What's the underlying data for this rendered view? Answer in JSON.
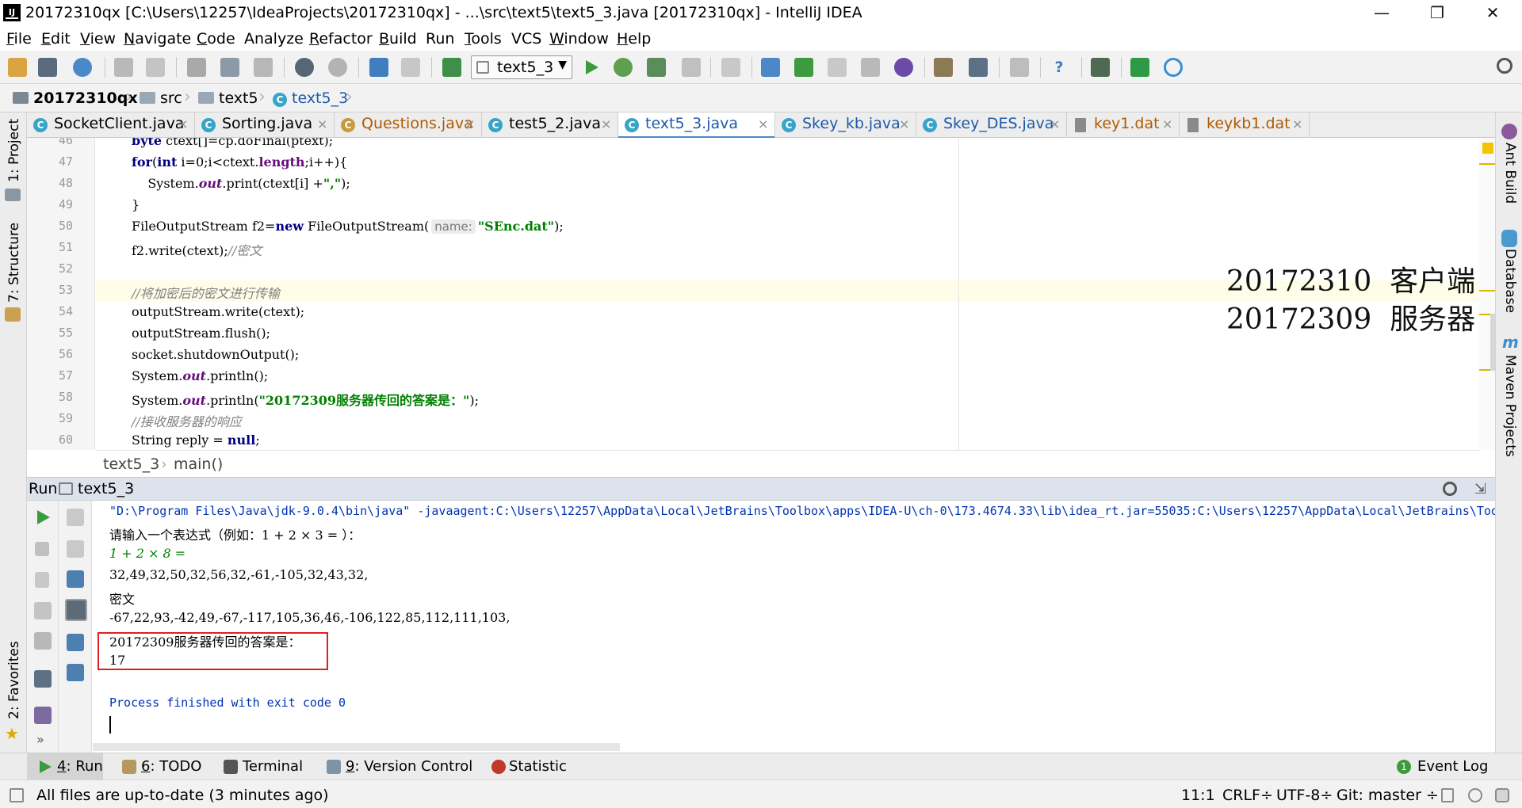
{
  "window": {
    "title": "20172310qx [C:\\Users\\12257\\IdeaProjects\\20172310qx] - ...\\src\\text5\\text5_3.java [20172310qx] - IntelliJ IDEA",
    "app_icon_label": "IJ",
    "minimize_glyph": "—",
    "maximize_glyph": "❐",
    "close_glyph": "✕"
  },
  "menu": {
    "items": [
      {
        "key": "F",
        "rest": "ile"
      },
      {
        "key": "E",
        "rest": "dit"
      },
      {
        "key": "V",
        "rest": "iew"
      },
      {
        "key": "N",
        "rest": "avigate"
      },
      {
        "key": "C",
        "rest": "ode"
      },
      {
        "key": "",
        "rest": "Analyze"
      },
      {
        "key": "R",
        "rest": "efactor"
      },
      {
        "key": "B",
        "rest": "uild"
      },
      {
        "key": "",
        "rest": "Run"
      },
      {
        "key": "T",
        "rest": "ools"
      },
      {
        "key": "",
        "rest": "VCS"
      },
      {
        "key": "W",
        "rest": "indow"
      },
      {
        "key": "H",
        "rest": "elp"
      }
    ]
  },
  "toolbar": {
    "run_config": "text5_3",
    "run_config_arrow": "▼",
    "colors": {
      "run": "#3c9b3c",
      "debug": "#5fa04e",
      "stop": "#c0c0c0",
      "accent_blue": "#4a88c7",
      "undo_purple": "#6b4aa8"
    }
  },
  "breadcrumb": {
    "project": "20172310qx",
    "folder1": "src",
    "folder2": "text5",
    "class": "text5_3",
    "sep": "›"
  },
  "tabs": [
    {
      "label": "SocketClient.java",
      "kind": "class",
      "color": "#000000",
      "active": false
    },
    {
      "label": "Sorting.java",
      "kind": "class",
      "color": "#000000",
      "active": false
    },
    {
      "label": "Questions.java",
      "kind": "class",
      "color": "#b05a00",
      "active": false
    },
    {
      "label": "test5_2.java",
      "kind": "class",
      "color": "#000000",
      "active": false
    },
    {
      "label": "text5_3.java",
      "kind": "class",
      "color": "#1d5aa8",
      "active": true
    },
    {
      "label": "Skey_kb.java",
      "kind": "class",
      "color": "#1d5aa8",
      "active": false
    },
    {
      "label": "Skey_DES.java",
      "kind": "class",
      "color": "#1d5aa8",
      "active": false
    },
    {
      "label": "key1.dat",
      "kind": "file",
      "color": "#b05a00",
      "active": false
    },
    {
      "label": "keykb1.dat",
      "kind": "file",
      "color": "#b05a00",
      "active": false
    }
  ],
  "tab_close_glyph": "×",
  "left_tools": {
    "project": "1: Project",
    "structure": "7: Structure",
    "favorites": "2: Favorites"
  },
  "right_tools": {
    "ant": "Ant Build",
    "database": "Database",
    "maven": "Maven Projects"
  },
  "editor": {
    "line_numbers": [
      "46",
      "47",
      "48",
      "49",
      "50",
      "51",
      "52",
      "53",
      "54",
      "55",
      "56",
      "57",
      "58",
      "59",
      "60"
    ],
    "l46": {
      "kw": "byte",
      "rest": " ctext[]=cp.doFinal(ptext);"
    },
    "l47": {
      "kw1": "for",
      "a": "(",
      "kw2": "int",
      "b": " i=0;i<ctext.",
      "fld": "length",
      "c": ";i++){"
    },
    "l48": {
      "a": "    System.",
      "fld": "out",
      "b": ".print(ctext[i] +",
      "str": "\",\"",
      "c": ");"
    },
    "l49": "}",
    "l50": {
      "a": "FileOutputStream f2=",
      "kw": "new",
      "b": " FileOutputStream(",
      "hint": "name:",
      "str": "\"SEnc.dat\"",
      "c": ");"
    },
    "l51": {
      "a": "f2.write(ctext);",
      "cmt": "//密文"
    },
    "l52": "",
    "l53": {
      "cmt": "//将加密后的密文进行传输"
    },
    "l54": "outputStream.write(ctext);",
    "l55": "outputStream.flush();",
    "l56": "socket.shutdownOutput();",
    "l57": {
      "a": "System.",
      "fld": "out",
      "b": ".println();"
    },
    "l58": {
      "a": "System.",
      "fld": "out",
      "b": ".println(",
      "str": "\"20172309服务器传回的答案是：\"",
      "c": ");"
    },
    "l59": {
      "cmt": "//接收服务器的响应"
    },
    "l60": {
      "a": "String reply = ",
      "kw": "null",
      "b": ";"
    },
    "overlay_line1": "20172310  客户端",
    "overlay_line2": "20172309  服务器"
  },
  "editor_crumbs": {
    "cls": "text5_3",
    "sep": "›",
    "method": "main()"
  },
  "run_panel": {
    "title": "Run",
    "tab": "text5_3",
    "lines": {
      "cmd": "\"D:\\Program Files\\Java\\jdk-9.0.4\\bin\\java\" -javaagent:C:\\Users\\12257\\AppData\\Local\\JetBrains\\Toolbox\\apps\\IDEA-U\\ch-0\\173.4674.33\\lib\\idea_rt.jar=55035:C:\\Users\\12257\\AppData\\Local\\JetBrains\\Toolbox",
      "prompt": "请输入一个表达式（例如：1 + 2 × 3 = ）：",
      "input": "1 + 2 × 8 =",
      "bytes": "32,49,32,50,32,56,32,-61,-105,32,43,32,",
      "cipher_label": "密文",
      "cipher": "-67,22,93,-42,49,-67,-117,105,36,46,-106,122,85,112,111,103,",
      "answer_label": "20172309服务器传回的答案是：",
      "answer": "17",
      "exit": "Process finished with exit code 0"
    }
  },
  "tool_windows": {
    "run": {
      "num": "4",
      "text": ": Run"
    },
    "todo": {
      "num": "6",
      "text": ": TODO"
    },
    "terminal": "Terminal",
    "vcs": {
      "num": "9",
      "text": ": Version Control"
    },
    "statistic": "Statistic",
    "event_log": "Event Log",
    "event_count": "1"
  },
  "status": {
    "message": "All files are up-to-date (3 minutes ago)",
    "position": "11:1",
    "line_sep": "CRLF÷",
    "encoding": "UTF-8÷",
    "git": "Git: master ÷"
  }
}
